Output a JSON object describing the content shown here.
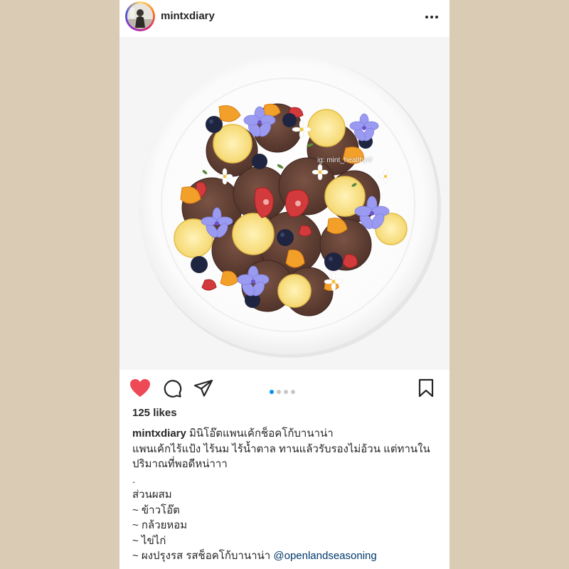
{
  "post": {
    "username": "mintxdiary",
    "watermark": "ig: mint_healthylif",
    "likes": "125 likes",
    "carousel": {
      "total": 4,
      "active": 0
    },
    "caption": {
      "username": "mintxdiary",
      "title": "มินิโอ๊ตแพนเค้กช็อคโก้บานาน่า",
      "lines": [
        "แพนเค้กไร้แป้ง ไร้นม ไร้น้ำตาล ทานแล้วรับรองไม่อ้วน แต่ทานใน",
        "ปริมาณที่พอดีหน่าาา",
        ".",
        "ส่วนผสม",
        "~ ข้าวโอ๊ต",
        "~ กล้วยหอม",
        "~ ไข่ไก่"
      ],
      "last_line_text": "~ ผงปรุงรส รสช็อคโก้บานาน่า ",
      "mention": "@openlandseasoning"
    }
  },
  "colors": {
    "heart": "#ed4956",
    "link": "#00376b",
    "active_dot": "#0095f6",
    "background": "#d9cbb4"
  },
  "icons": {
    "more": "more-options-icon",
    "like": "heart-filled-icon",
    "comment": "comment-icon",
    "share": "paper-plane-icon",
    "save": "bookmark-icon"
  }
}
